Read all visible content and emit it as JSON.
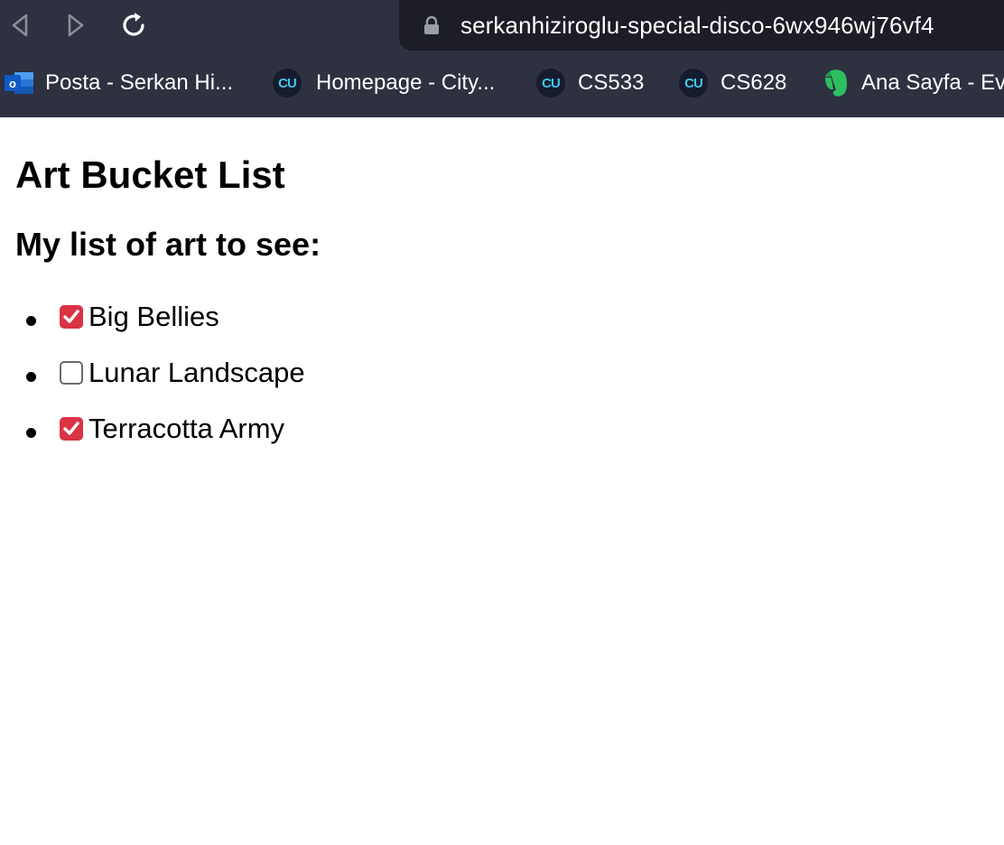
{
  "browser": {
    "url": "serkanhiziroglu-special-disco-6wx946wj76vf4",
    "bookmarks": [
      {
        "label": "Posta - Serkan Hi...",
        "icon": "outlook-icon"
      },
      {
        "label": "Homepage - City...",
        "icon": "cu-icon",
        "badge": "CU"
      },
      {
        "label": "CS533",
        "icon": "cu-icon",
        "badge": "CU"
      },
      {
        "label": "CS628",
        "icon": "cu-icon",
        "badge": "CU"
      },
      {
        "label": "Ana Sayfa - Ev",
        "icon": "evernote-icon"
      }
    ],
    "colors": {
      "chrome": "#2e3140",
      "url_bar": "#1c1d26",
      "cu_accent": "#41c6e8"
    }
  },
  "page": {
    "title": "Art Bucket List",
    "list_heading": "My list of art to see:",
    "items": [
      {
        "label": "Big Bellies",
        "checked": true
      },
      {
        "label": "Lunar Landscape",
        "checked": false
      },
      {
        "label": "Terracotta Army",
        "checked": true
      }
    ],
    "colors": {
      "checkbox_checked": "#d93344"
    }
  }
}
